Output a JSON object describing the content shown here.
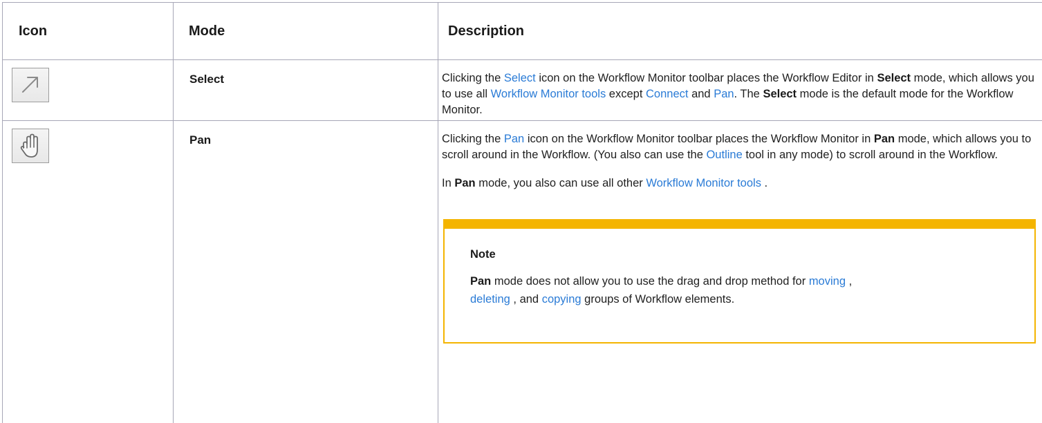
{
  "table": {
    "headers": {
      "icon": "Icon",
      "mode": "Mode",
      "description": "Description"
    },
    "rows": [
      {
        "icon": "select-arrow-icon",
        "mode": "Select",
        "desc": {
          "t1": "Clicking the ",
          "l1": "Select",
          "t2": " icon on the Workflow Monitor toolbar places the Workflow Editor in ",
          "b1": "Select",
          "t3": " mode, which allows you to use all ",
          "l2": "Workflow Monitor tools",
          "t4": " except ",
          "l3": "Connect",
          "t5": " and ",
          "l4": "Pan",
          "t6": ". The ",
          "b2": "Select",
          "t7": " mode is the default mode for the Workflow Monitor."
        }
      },
      {
        "icon": "pan-hand-icon",
        "mode": "Pan",
        "desc": {
          "p1": {
            "t1": "Clicking the ",
            "l1": "Pan",
            "t2": " icon on the Workflow Monitor toolbar places the Workflow Monitor in ",
            "b1": "Pan",
            "t3": " mode, which allows you to scroll around in the Workflow. (You also can use the ",
            "l2": "Outline",
            "t4": " tool in any mode) to scroll around in the Workflow."
          },
          "p2": {
            "t1": "In ",
            "b1": "Pan",
            "t2": " mode, you also can use all other ",
            "l1": "Workflow Monitor tools",
            "t3": " ."
          },
          "note": {
            "title": "Note",
            "b1": "Pan",
            "t1": " mode does not allow you to use the drag and drop method for ",
            "l1": "moving",
            "t2": " , ",
            "l2": "deleting",
            "t3": " , and ",
            "l3": "copying",
            "t4": " groups of Workflow elements."
          }
        }
      }
    ]
  },
  "colors": {
    "link": "#2a7bd6",
    "note_accent": "#f4b400",
    "border": "#a6a6b6"
  }
}
